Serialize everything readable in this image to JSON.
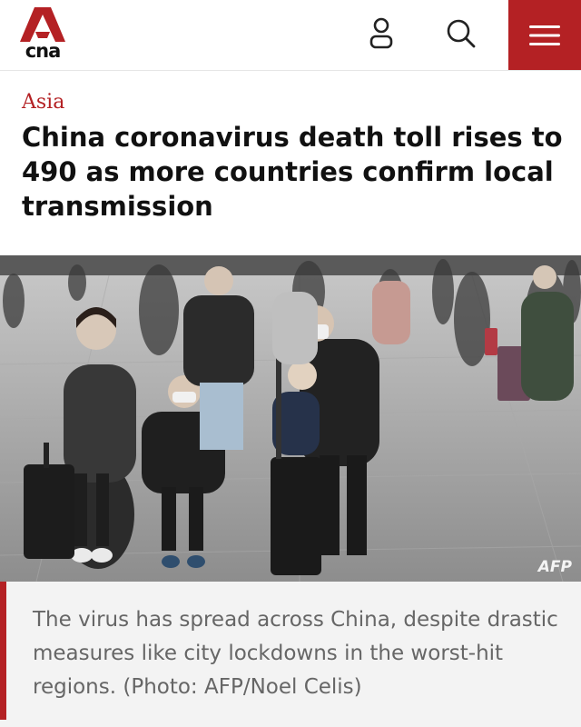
{
  "header": {
    "logo_text": "cna",
    "icons": {
      "account": "user-icon",
      "search": "search-icon",
      "menu": "hamburger-menu-icon"
    },
    "colors": {
      "brand_red": "#b42124"
    }
  },
  "article": {
    "category": "Asia",
    "headline": "China coronavirus death toll rises to 490 as more countries confirm local transmission",
    "photo_credit_mark": "AFP",
    "caption": "The virus has spread across China, despite drastic measures like city lockdowns in the worst-hit regions. (Photo: AFP/Noel Celis)"
  }
}
